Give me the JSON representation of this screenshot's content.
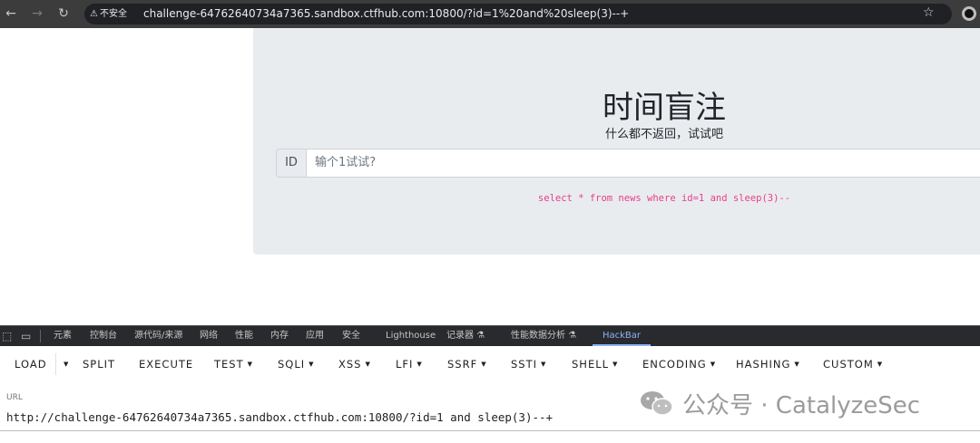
{
  "browser": {
    "security_label": "不安全",
    "url": "challenge-64762640734a7365.sandbox.ctfhub.com:10800/?id=1%20and%20sleep(3)--+"
  },
  "page": {
    "title": "时间盲注",
    "subtitle": "什么都不返回，试试吧",
    "id_label": "ID",
    "input_placeholder": "输个1试试?",
    "sql_query": "select * from news where id=1 and sleep(3)--"
  },
  "devtools": {
    "tabs": [
      "元素",
      "控制台",
      "源代码/来源",
      "网络",
      "性能",
      "内存",
      "应用",
      "安全",
      "Lighthouse",
      "记录器 ⚗",
      "性能数据分析 ⚗",
      "HackBar"
    ],
    "active_tab": "HackBar"
  },
  "hackbar": {
    "buttons": [
      "LOAD",
      "SPLIT",
      "EXECUTE",
      "TEST",
      "SQLI",
      "XSS",
      "LFI",
      "SSRF",
      "SSTI",
      "SHELL",
      "ENCODING",
      "HASHING",
      "CUSTOM"
    ],
    "url_label": "URL",
    "url_value": "http://challenge-64762640734a7365.sandbox.ctfhub.com:10800/?id=1 and sleep(3)--+"
  },
  "watermark": {
    "text": "公众号 · CatalyzeSec"
  },
  "icons": {
    "back": "back-arrow-icon",
    "forward": "forward-arrow-icon",
    "reload": "reload-icon",
    "warning": "warning-icon",
    "star": "bookmark-star-icon",
    "profile": "profile-icon",
    "inspect": "inspect-element-icon",
    "device": "device-toolbar-icon"
  },
  "colors": {
    "sql_text": "#e83e8c",
    "active_tab": "#8ab4f8",
    "jumbotron": "#e9ecef"
  }
}
